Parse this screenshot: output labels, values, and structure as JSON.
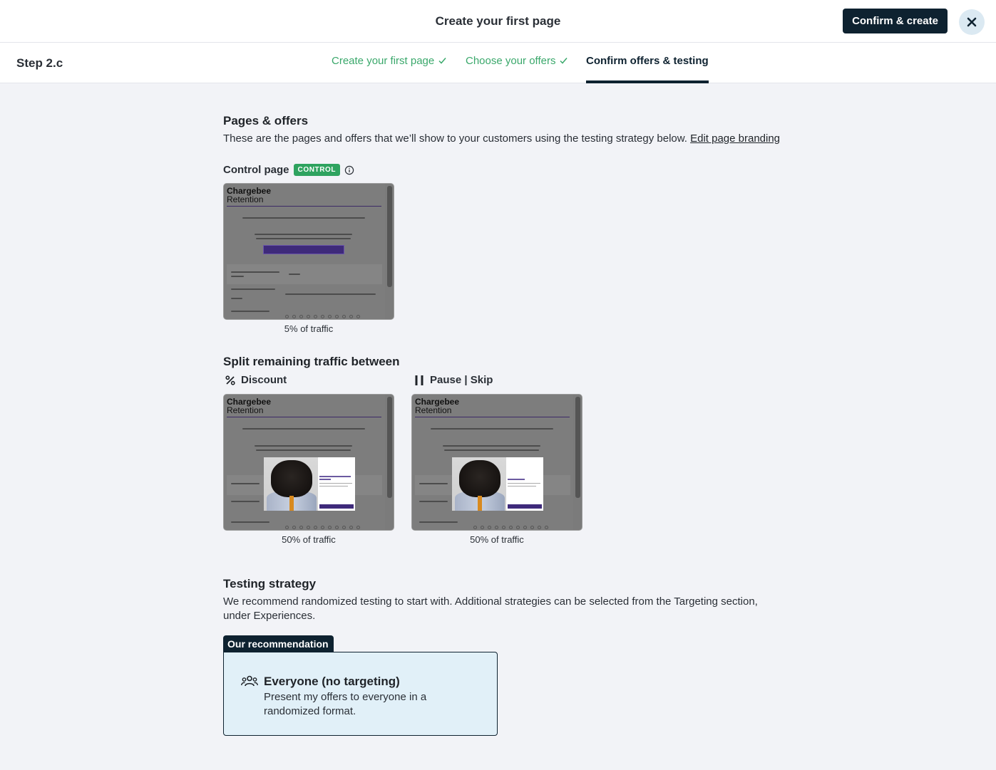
{
  "header": {
    "title": "Create your first page",
    "confirm_label": "Confirm & create",
    "close_icon": "close-icon"
  },
  "stepbar": {
    "step": "Step 2.c",
    "tabs": [
      {
        "label": "Create your first page",
        "state": "done"
      },
      {
        "label": "Choose your offers",
        "state": "done"
      },
      {
        "label": "Confirm offers & testing",
        "state": "active"
      }
    ]
  },
  "pages_offers": {
    "heading": "Pages & offers",
    "description": "These are the pages and offers that we’ll show to your customers using the testing strategy below.",
    "edit_link": "Edit page branding"
  },
  "control": {
    "label": "Control page",
    "badge": "CONTROL",
    "traffic": "5% of traffic"
  },
  "preview": {
    "brand_line1": "Chargebee",
    "brand_line2": "Retention"
  },
  "split": {
    "heading": "Split remaining traffic between",
    "offers": [
      {
        "label": "Discount",
        "icon": "percent-icon",
        "traffic": "50% of traffic"
      },
      {
        "label": "Pause | Skip",
        "icon": "pause-icon",
        "traffic": "50% of traffic"
      }
    ]
  },
  "testing": {
    "heading": "Testing strategy",
    "description": "We recommend randomized testing to start with. Additional strategies can be selected from the Targeting section, under Experiences.",
    "recommendation_tab": "Our recommendation",
    "option_title": "Everyone (no targeting)",
    "option_desc": "Present my offers to everyone in a randomized format."
  },
  "colors": {
    "primary": "#0e2230",
    "done_green": "#3aa86b",
    "control_badge": "#2ea35f",
    "card_bg": "#e1f0f8"
  }
}
